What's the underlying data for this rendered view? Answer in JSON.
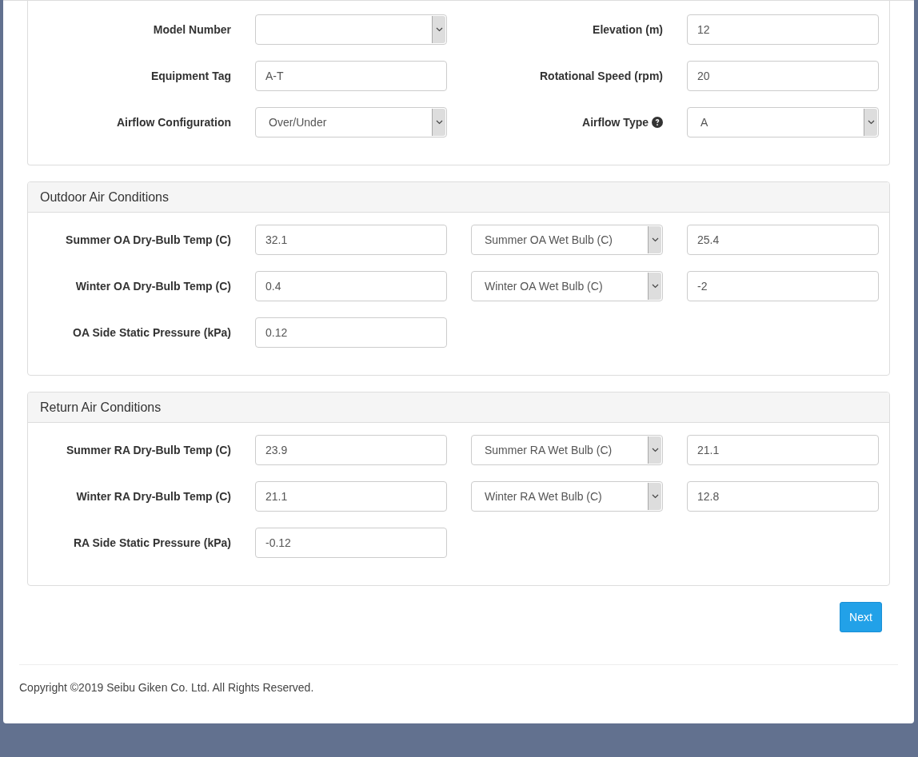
{
  "panels": [
    {
      "rows": [
        [
          {
            "kind": "label",
            "text": "Model Number"
          },
          {
            "kind": "select"
          },
          {
            "kind": "label",
            "text": "Elevation (m)"
          },
          {
            "kind": "input",
            "value": "12"
          }
        ],
        [
          {
            "kind": "label",
            "text": "Equipment Tag"
          },
          {
            "kind": "input",
            "value": "A-T"
          },
          {
            "kind": "label",
            "text": "Rotational Speed (rpm)"
          },
          {
            "kind": "input",
            "value": "20"
          }
        ],
        [
          {
            "kind": "label",
            "text": "Airflow Configuration"
          },
          {
            "kind": "select",
            "value": "Over/Under"
          },
          {
            "kind": "label",
            "text": "Airflow Type",
            "help": true
          },
          {
            "kind": "select",
            "value": "A"
          }
        ]
      ]
    },
    {
      "title": "Outdoor Air Conditions",
      "rows": [
        [
          {
            "kind": "label",
            "text": "Summer OA Dry-Bulb Temp (C)"
          },
          {
            "kind": "input",
            "value": "32.1"
          },
          {
            "kind": "select",
            "value": "Summer OA Wet Bulb (C)"
          },
          {
            "kind": "input",
            "value": "25.4"
          }
        ],
        [
          {
            "kind": "label",
            "text": "Winter OA Dry-Bulb Temp (C)"
          },
          {
            "kind": "input",
            "value": "0.4"
          },
          {
            "kind": "select",
            "value": "Winter OA Wet Bulb (C)"
          },
          {
            "kind": "input",
            "value": "-2"
          }
        ],
        [
          {
            "kind": "label",
            "text": "OA Side Static Pressure (kPa)"
          },
          {
            "kind": "input",
            "value": "0.12"
          }
        ]
      ]
    },
    {
      "title": "Return Air Conditions",
      "rows": [
        [
          {
            "kind": "label",
            "text": "Summer RA Dry-Bulb Temp (C)"
          },
          {
            "kind": "input",
            "value": "23.9"
          },
          {
            "kind": "select",
            "value": "Summer RA Wet Bulb (C)"
          },
          {
            "kind": "input",
            "value": "21.1"
          }
        ],
        [
          {
            "kind": "label",
            "text": "Winter RA Dry-Bulb Temp (C)"
          },
          {
            "kind": "input",
            "value": "21.1"
          },
          {
            "kind": "select",
            "value": "Winter RA Wet Bulb (C)"
          },
          {
            "kind": "input",
            "value": "12.8"
          }
        ],
        [
          {
            "kind": "label",
            "text": "RA Side Static Pressure (kPa)"
          },
          {
            "kind": "input",
            "value": "-0.12"
          }
        ]
      ]
    }
  ],
  "next_button": "Next",
  "footer": "Copyright ©2019 Seibu Giken Co. Ltd. All Rights Reserved."
}
